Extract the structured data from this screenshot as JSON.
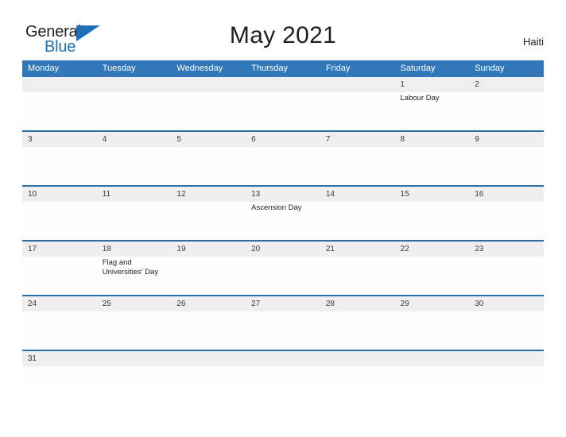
{
  "brand": {
    "name_part1": "General",
    "name_part2": "Blue",
    "triangle_color": "#1f6fb5"
  },
  "header": {
    "title": "May 2021",
    "country": "Haiti"
  },
  "theme": {
    "header_blue": "#3277b8",
    "rule_blue": "#2f6fa8",
    "date_band_gray": "#efefef",
    "text_dark": "#231f20"
  },
  "calendar": {
    "weekdays": [
      "Monday",
      "Tuesday",
      "Wednesday",
      "Thursday",
      "Friday",
      "Saturday",
      "Sunday"
    ],
    "weeks": [
      {
        "days": [
          {
            "date": "",
            "events": []
          },
          {
            "date": "",
            "events": []
          },
          {
            "date": "",
            "events": []
          },
          {
            "date": "",
            "events": []
          },
          {
            "date": "",
            "events": []
          },
          {
            "date": "1",
            "events": [
              "Labour Day"
            ]
          },
          {
            "date": "2",
            "events": []
          }
        ]
      },
      {
        "days": [
          {
            "date": "3",
            "events": []
          },
          {
            "date": "4",
            "events": []
          },
          {
            "date": "5",
            "events": []
          },
          {
            "date": "6",
            "events": []
          },
          {
            "date": "7",
            "events": []
          },
          {
            "date": "8",
            "events": []
          },
          {
            "date": "9",
            "events": []
          }
        ]
      },
      {
        "days": [
          {
            "date": "10",
            "events": []
          },
          {
            "date": "11",
            "events": []
          },
          {
            "date": "12",
            "events": []
          },
          {
            "date": "13",
            "events": [
              "Ascension Day"
            ]
          },
          {
            "date": "14",
            "events": []
          },
          {
            "date": "15",
            "events": []
          },
          {
            "date": "16",
            "events": []
          }
        ]
      },
      {
        "days": [
          {
            "date": "17",
            "events": []
          },
          {
            "date": "18",
            "events": [
              "Flag and Universities’ Day"
            ]
          },
          {
            "date": "19",
            "events": []
          },
          {
            "date": "20",
            "events": []
          },
          {
            "date": "21",
            "events": []
          },
          {
            "date": "22",
            "events": []
          },
          {
            "date": "23",
            "events": []
          }
        ]
      },
      {
        "days": [
          {
            "date": "24",
            "events": []
          },
          {
            "date": "25",
            "events": []
          },
          {
            "date": "26",
            "events": []
          },
          {
            "date": "27",
            "events": []
          },
          {
            "date": "28",
            "events": []
          },
          {
            "date": "29",
            "events": []
          },
          {
            "date": "30",
            "events": []
          }
        ]
      },
      {
        "days": [
          {
            "date": "31",
            "events": []
          },
          {
            "date": "",
            "events": []
          },
          {
            "date": "",
            "events": []
          },
          {
            "date": "",
            "events": []
          },
          {
            "date": "",
            "events": []
          },
          {
            "date": "",
            "events": []
          },
          {
            "date": "",
            "events": []
          }
        ]
      }
    ]
  }
}
